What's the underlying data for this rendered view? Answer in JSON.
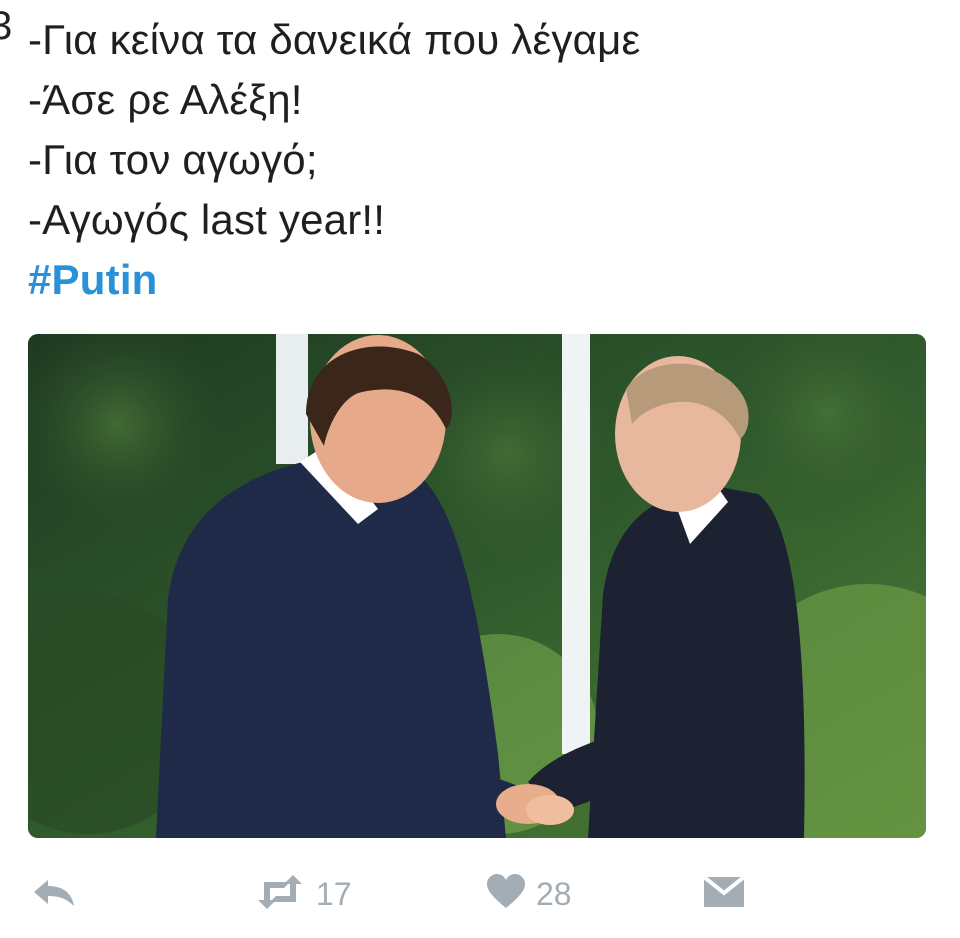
{
  "tweet": {
    "lines": [
      "-Για κείνα τα δανεικά που λέγαμε",
      "-Άσε ρε Αλέξη!",
      "-Για τον αγωγό;",
      "-Αγωγός last year!!"
    ],
    "hashtag": "#Putin"
  },
  "actions": {
    "reply_icon": "reply-icon",
    "retweet_icon": "retweet-icon",
    "retweet_count": "17",
    "like_icon": "heart-icon",
    "like_count": "28",
    "dm_icon": "envelope-icon"
  },
  "colors": {
    "text": "#1f1f1f",
    "hashtag": "#2a90d8",
    "action_gray": "#a3adb5"
  }
}
